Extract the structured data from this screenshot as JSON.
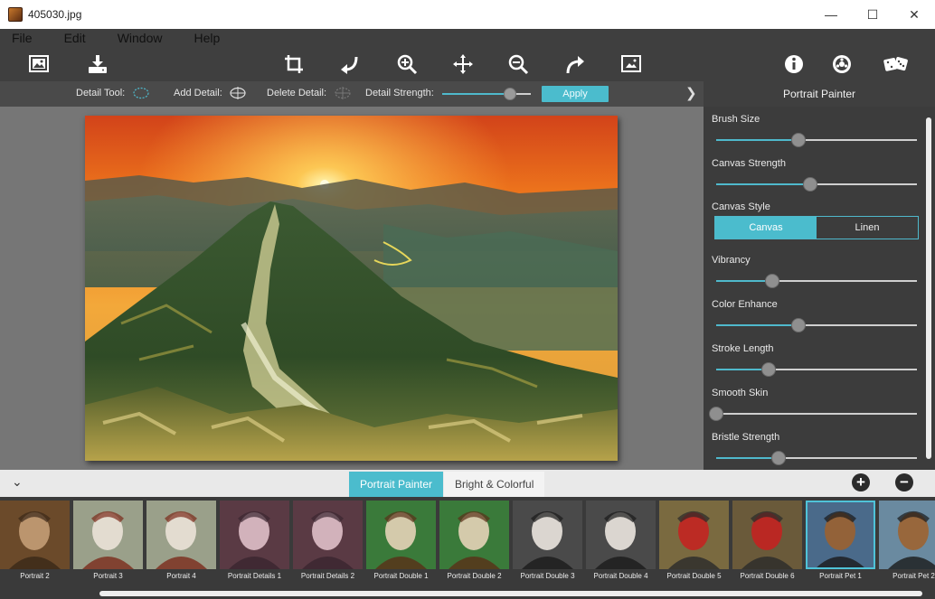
{
  "window": {
    "title": "405030.jpg",
    "minimize": "—",
    "maximize": "☐",
    "close": "✕"
  },
  "menu": [
    "File",
    "Edit",
    "Window",
    "Help"
  ],
  "toolbar": {
    "icons": [
      "open-image-icon",
      "save-icon",
      "crop-icon",
      "undo-icon",
      "zoom-in-icon",
      "move-icon",
      "zoom-out-icon",
      "redo-icon",
      "fit-image-icon",
      "info-icon",
      "settings-icon",
      "random-dice-icon"
    ]
  },
  "detail_bar": {
    "detail_tool": "Detail Tool:",
    "add_detail": "Add Detail:",
    "delete_detail": "Delete Detail:",
    "detail_strength": "Detail Strength:",
    "strength_value": 0.77,
    "apply": "Apply"
  },
  "panel": {
    "title": "Portrait Painter",
    "sliders": [
      {
        "label": "Brush Size",
        "value": 0.41
      },
      {
        "label": "Canvas Strength",
        "value": 0.47
      },
      {
        "label": "Vibrancy",
        "value": 0.28
      },
      {
        "label": "Color Enhance",
        "value": 0.41
      },
      {
        "label": "Stroke Length",
        "value": 0.26
      },
      {
        "label": "Smooth Skin",
        "value": 0.0
      },
      {
        "label": "Bristle Strength",
        "value": 0.31
      }
    ],
    "canvas_style": {
      "label": "Canvas Style",
      "options": [
        "Canvas",
        "Linen"
      ],
      "selected": "Canvas"
    }
  },
  "tabs": {
    "active": "Portrait Painter",
    "inactive": "Bright & Colorful"
  },
  "presets": [
    "Portrait 2",
    "Portrait 3",
    "Portrait 4",
    "Portrait Details 1",
    "Portrait Details 2",
    "Portrait Double 1",
    "Portrait Double 2",
    "Portrait Double 3",
    "Portrait Double 4",
    "Portrait Double 5",
    "Portrait Double 6",
    "Portrait Pet 1",
    "Portrait Pet 2"
  ],
  "selected_preset": "Portrait Pet 1",
  "colors": {
    "accent": "#4bbccd",
    "panel_bg": "#3c3c3c",
    "workspace_bg": "#767676"
  }
}
